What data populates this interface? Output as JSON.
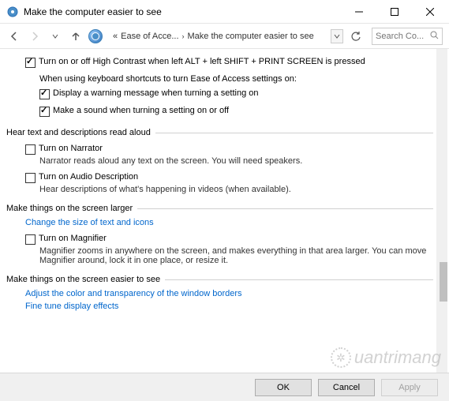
{
  "window": {
    "title": "Make the computer easier to see"
  },
  "breadcrumb": {
    "prefix": "«",
    "item1": "Ease of Acce...",
    "item2": "Make the computer easier to see"
  },
  "search": {
    "placeholder": "Search Co..."
  },
  "options": {
    "high_contrast": {
      "label": "Turn on or off High Contrast when left ALT + left SHIFT + PRINT SCREEN is pressed",
      "checked": true,
      "sub_heading": "When using keyboard shortcuts to turn Ease of Access settings on:",
      "warn": {
        "label": "Display a warning message when turning a setting on",
        "checked": true
      },
      "sound": {
        "label": "Make a sound when turning a setting on or off",
        "checked": true
      }
    }
  },
  "sections": {
    "hear": {
      "title": "Hear text and descriptions read aloud",
      "narrator": {
        "label": "Turn on Narrator",
        "checked": false,
        "desc": "Narrator reads aloud any text on the screen. You will need speakers."
      },
      "audio_desc": {
        "label": "Turn on Audio Description",
        "checked": false,
        "desc": "Hear descriptions of what's happening in videos (when available)."
      }
    },
    "larger": {
      "title": "Make things on the screen larger",
      "link": "Change the size of text and icons",
      "magnifier": {
        "label": "Turn on Magnifier",
        "checked": false,
        "desc": "Magnifier zooms in anywhere on the screen, and makes everything in that area larger. You can move Magnifier around, lock it in one place, or resize it."
      }
    },
    "easier": {
      "title": "Make things on the screen easier to see",
      "link1": "Adjust the color and transparency of the window borders",
      "link2": "Fine tune display effects"
    }
  },
  "buttons": {
    "ok": "OK",
    "cancel": "Cancel",
    "apply": "Apply"
  },
  "watermark": "uantrimang"
}
